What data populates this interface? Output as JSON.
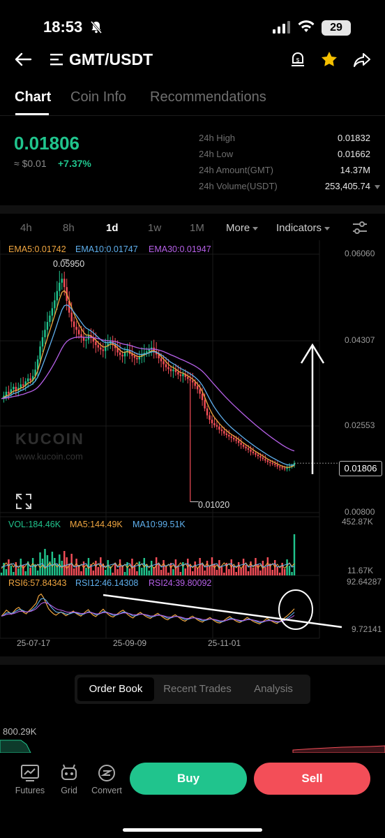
{
  "status_bar": {
    "time": "18:53",
    "battery": "29"
  },
  "header": {
    "pair": "GMT/USDT"
  },
  "tabs": [
    {
      "label": "Chart"
    },
    {
      "label": "Coin Info"
    },
    {
      "label": "Recommendations"
    }
  ],
  "ticker": {
    "price": "0.01806",
    "usd": "≈ $0.01",
    "change": "+7.37%",
    "stats": [
      {
        "label": "24h High",
        "value": "0.01832"
      },
      {
        "label": "24h Low",
        "value": "0.01662"
      },
      {
        "label": "24h Amount(GMT)",
        "value": "14.37M"
      },
      {
        "label": "24h Volume(USDT)",
        "value": "253,405.74"
      }
    ]
  },
  "timeframes": {
    "items": [
      "4h",
      "8h",
      "1d",
      "1w",
      "1M"
    ],
    "active": "1d",
    "more": "More",
    "indicators": "Indicators"
  },
  "chart_data": {
    "type": "line",
    "title": "",
    "xlabel": "",
    "ylabel": "",
    "ema_legend": [
      "EMA5:0.01742",
      "EMA10:0.01747",
      "EMA30:0.01947"
    ],
    "vol_legend": [
      "VOL:184.46K",
      "MA5:144.49K",
      "MA10:99.51K"
    ],
    "rsi_legend": [
      "RSI6:57.84343",
      "RSI12:46.14308",
      "RSI24:39.80092"
    ],
    "price_axis": [
      "0.06060",
      "0.04307",
      "0.02553",
      "0.00800"
    ],
    "vol_axis": [
      "452.87K",
      "11.67K"
    ],
    "rsi_axis": [
      "92.64287",
      "9.72141"
    ],
    "x_ticks": [
      "25-07-17",
      "25-09-09",
      "25-11-01"
    ],
    "high_label": "0.05950",
    "low_label": "0.01020",
    "current_price": "0.01806",
    "ylim": [
      0.008,
      0.0606
    ],
    "close_series": [
      0.0312,
      0.0318,
      0.0326,
      0.0322,
      0.0331,
      0.0336,
      0.0329,
      0.0334,
      0.0341,
      0.0338,
      0.0347,
      0.0353,
      0.0349,
      0.0358,
      0.0371,
      0.0392,
      0.0418,
      0.0437,
      0.0452,
      0.0468,
      0.0481,
      0.0496,
      0.0512,
      0.0531,
      0.0548,
      0.0556,
      0.0539,
      0.0511,
      0.0487,
      0.0469,
      0.0458,
      0.0452,
      0.0443,
      0.0437,
      0.043,
      0.0432,
      0.0441,
      0.0436,
      0.0428,
      0.0421,
      0.0416,
      0.0412,
      0.0409,
      0.0418,
      0.0424,
      0.0429,
      0.0422,
      0.0415,
      0.0406,
      0.0401,
      0.0398,
      0.0406,
      0.0411,
      0.0403,
      0.0399,
      0.0395,
      0.0392,
      0.0397,
      0.0401,
      0.0405,
      0.0408,
      0.0412,
      0.0416,
      0.0409,
      0.0402,
      0.0394,
      0.0388,
      0.0382,
      0.0376,
      0.0372,
      0.0368,
      0.0371,
      0.0366,
      0.0361,
      0.0358,
      0.0362,
      0.0356,
      0.0352,
      0.0349,
      0.0345,
      0.0338,
      0.0331,
      0.0322,
      0.0309,
      0.0292,
      0.0278,
      0.0269,
      0.0262,
      0.0258,
      0.0255,
      0.0249,
      0.0246,
      0.0241,
      0.0238,
      0.0235,
      0.0232,
      0.0229,
      0.0226,
      0.0222,
      0.0218,
      0.0214,
      0.0211,
      0.0208,
      0.0204,
      0.0201,
      0.0198,
      0.0195,
      0.0192,
      0.0189,
      0.0186,
      0.0183,
      0.0181,
      0.0179,
      0.0177,
      0.0174,
      0.0172,
      0.017,
      0.0169,
      0.0171,
      0.0173,
      0.0176,
      0.0181
    ],
    "rsi_series": [
      42,
      48,
      55,
      51,
      46,
      52,
      58,
      61,
      55,
      50,
      47,
      53,
      58,
      64,
      70,
      86,
      90,
      82,
      70,
      58,
      52,
      47,
      44,
      48,
      51,
      47,
      43,
      46,
      50,
      53,
      48,
      45,
      42,
      47,
      52,
      56,
      49,
      44,
      41,
      46,
      52,
      57,
      51,
      46,
      42,
      40,
      44,
      48,
      52,
      55,
      50,
      45,
      41,
      38,
      43,
      47,
      50,
      46,
      42,
      39,
      37,
      41,
      45,
      48,
      44,
      40,
      36,
      34,
      38,
      42,
      45,
      41,
      37,
      33,
      31,
      35,
      39,
      42,
      38,
      34,
      31,
      29,
      33,
      36,
      39,
      35,
      31,
      28,
      27,
      30,
      34,
      38,
      41,
      37,
      33,
      30,
      28,
      31,
      35,
      39,
      36,
      32,
      29,
      27,
      25,
      29,
      33,
      37,
      34,
      31,
      28,
      26,
      30,
      34,
      38,
      42,
      47,
      52,
      58
    ]
  },
  "orderbook": {
    "tabs": [
      "Order Book",
      "Recent Trades",
      "Analysis"
    ],
    "value": "800.29K"
  },
  "bottom_nav": [
    {
      "label": "Futures"
    },
    {
      "label": "Grid"
    },
    {
      "label": "Convert"
    }
  ],
  "actions": {
    "buy": "Buy",
    "sell": "Sell"
  },
  "watermark": {
    "brand": "KUCOIN",
    "url": "www.kucoin.com"
  },
  "colors": {
    "green": "#20c48d",
    "red": "#f34e58",
    "ema5": "#f0a640",
    "ema10": "#5fb0ee",
    "ema30": "#b660e8"
  }
}
